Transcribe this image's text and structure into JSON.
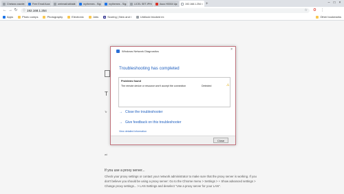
{
  "browser": {
    "tabs": [
      {
        "label": "Chelsea crawley",
        "icon": "gray",
        "active": false
      },
      {
        "label": "Free Email Accoun",
        "icon": "blue",
        "active": false
      },
      {
        "label": "webmail.talktalk.c",
        "icon": "gray",
        "active": false
      },
      {
        "label": "mythemes - Sign",
        "icon": "blue",
        "active": false
      },
      {
        "label": "mythemes - Sign",
        "icon": "blue",
        "active": false
      },
      {
        "label": "LICEL SET-IPHL ?",
        "icon": "gray",
        "active": false
      },
      {
        "label": "Asus H0004 Upgr",
        "icon": "red",
        "active": false
      },
      {
        "label": "192.168.1.254",
        "icon": "white",
        "active": true
      }
    ],
    "url": "192.168.1.254",
    "bookmarks": [
      {
        "label": "Apps",
        "icon": "apps"
      },
      {
        "label": "Photo comps",
        "icon": "folder"
      },
      {
        "label": "Photography",
        "icon": "folder"
      },
      {
        "label": "Electronic",
        "icon": "folder"
      },
      {
        "label": "Jobs",
        "icon": "folder"
      },
      {
        "label": "Scoring | New and i",
        "icon": "n"
      },
      {
        "label": "Unblock blocked ex",
        "icon": "g"
      }
    ],
    "other_bookmarks": "Other bookmarks"
  },
  "page": {
    "bg_title_fragment": "T",
    "bg_line_fragment": "Tr",
    "bg_mid_fragment": "wi",
    "proxy_heading": "If you use a proxy server...",
    "proxy_body": "Check your proxy settings or contact your network administrator to make sure that the proxy server is working. If you don't believe you should be using a proxy server: Go to the Chrome menu > Settings > + Show advanced settings > Change proxy settings... > LAN Settings and deselect \"Use a proxy server for your LAN\"."
  },
  "dialog": {
    "window_title": "Windows Network Diagnostics",
    "heading": "Troubleshooting has completed",
    "problems_header": "Problems found",
    "problem_desc": "The remote device or resource won't accept the connection",
    "problem_status": "Detected",
    "link_close": "Close the troubleshooter",
    "link_feedback": "Give feedback on this troubleshooter",
    "detail_link": "View detailed information",
    "close_button": "Close"
  }
}
